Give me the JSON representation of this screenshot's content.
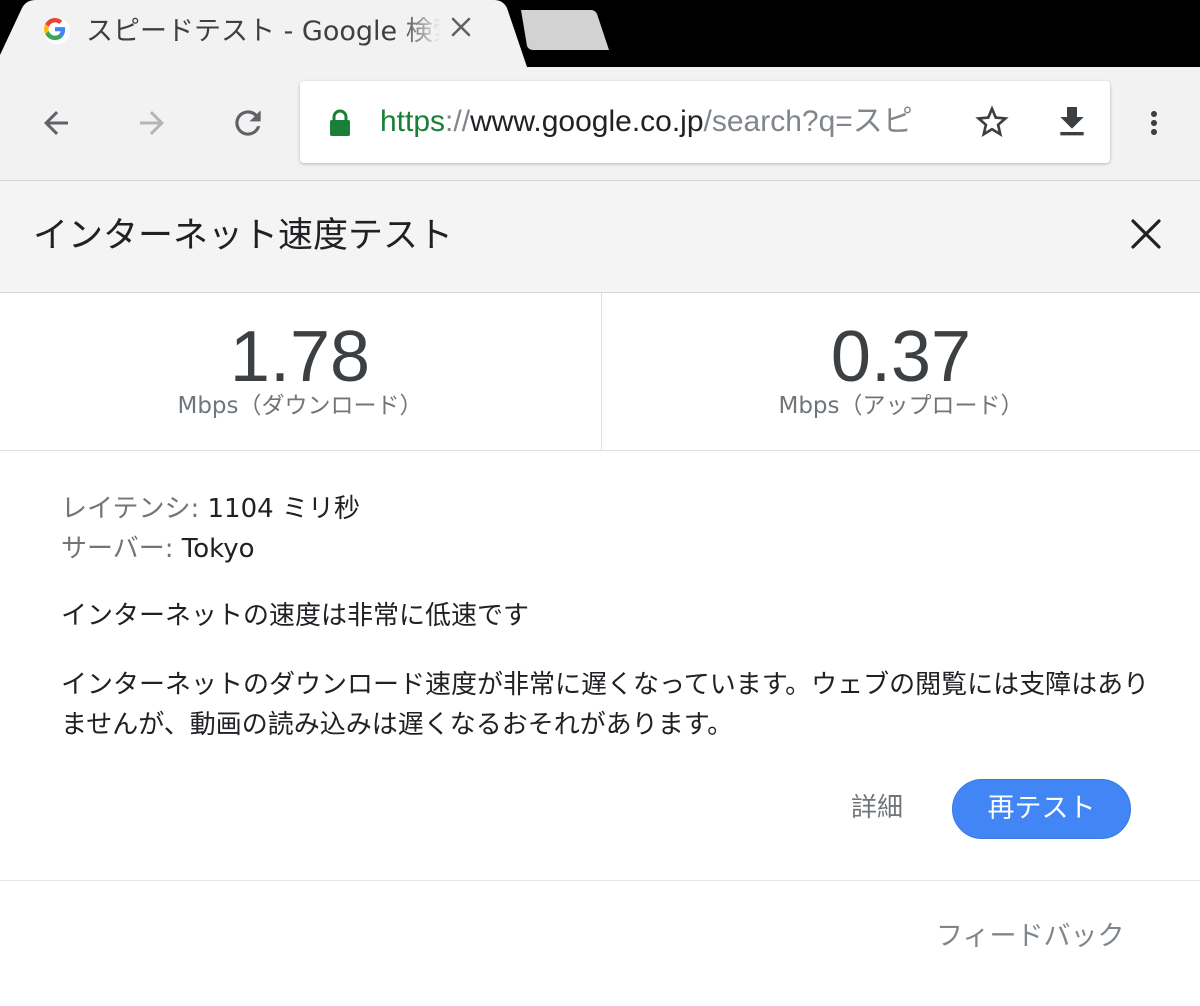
{
  "tab": {
    "title": "スピードテスト - Google 検索",
    "favicon": "google-g-icon",
    "close_icon": "close-icon"
  },
  "toolbar": {
    "back_icon": "arrow-back-icon",
    "forward_icon": "arrow-forward-icon",
    "reload_icon": "reload-icon",
    "url_scheme": "https",
    "url_separator": "://",
    "url_host": "www.google.co.jp",
    "url_path": "/search?q=スピ",
    "bookmark_icon": "star-outline-icon",
    "download_icon": "download-icon",
    "menu_icon": "more-vert-icon",
    "secure_color": "#188038"
  },
  "speed_test": {
    "title": "インターネット速度テスト",
    "download": {
      "value": "1.78",
      "unit": "Mbps（ダウンロード）"
    },
    "upload": {
      "value": "0.37",
      "unit": "Mbps（アップロード）"
    },
    "latency_label": "レイテンシ:",
    "latency_value": " 1104 ミリ秒",
    "server_label": "サーバー:",
    "server_value": " Tokyo",
    "summary": "インターネットの速度は非常に低速です",
    "description": "インターネットのダウンロード速度が非常に遅くなっています。ウェブの閲覧には支障はありませんが、動画の読み込みは遅くなるおそれがあります。",
    "details_button": "詳細",
    "retest_button": "再テスト",
    "feedback_link": "フィードバック",
    "accent_color": "#4285f4"
  }
}
